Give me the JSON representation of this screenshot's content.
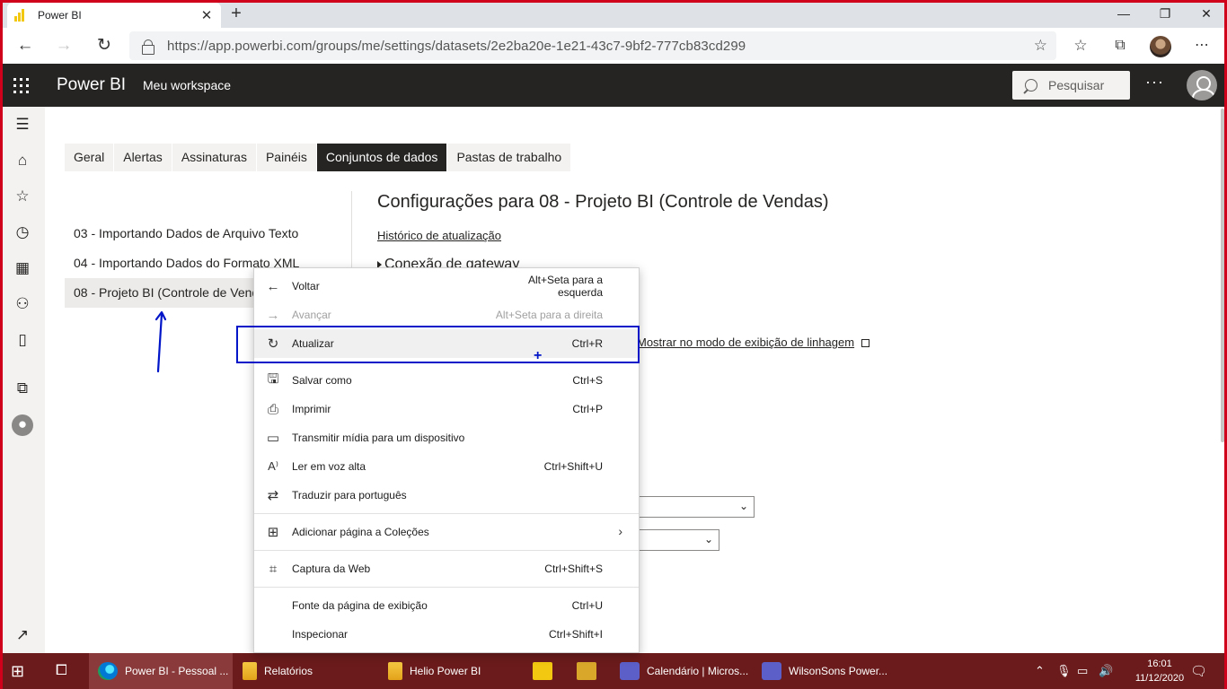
{
  "browser": {
    "tab_title": "Power BI",
    "url": "https://app.powerbi.com/groups/me/settings/datasets/2e2ba20e-1e21-43c7-9bf2-777cb83cd299"
  },
  "header": {
    "brand": "Power BI",
    "workspace": "Meu workspace",
    "search_placeholder": "Pesquisar"
  },
  "settings_tabs": [
    {
      "label": "Geral"
    },
    {
      "label": "Alertas"
    },
    {
      "label": "Assinaturas"
    },
    {
      "label": "Painéis"
    },
    {
      "label": "Conjuntos de dados",
      "active": true
    },
    {
      "label": "Pastas de trabalho"
    }
  ],
  "datasets": [
    {
      "label": "03 - Importando Dados de Arquivo Texto"
    },
    {
      "label": "04 - Importando Dados do Formato XML"
    },
    {
      "label": "08 - Projeto BI (Controle de Vendas)",
      "selected": true
    }
  ],
  "settings": {
    "title": "Configurações para 08 - Projeto BI (Controle de Vendas)",
    "refresh_history_link": "Histórico de atualização",
    "gateway_section": "Conexão de gateway",
    "lineage_link": "Mostrar no modo de exibição de linhagem"
  },
  "context_menu": {
    "items": [
      {
        "label": "Voltar",
        "shortcut": "Alt+Seta para a esquerda",
        "icon": "←"
      },
      {
        "label": "Avançar",
        "shortcut": "Alt+Seta para a direita",
        "icon": "→",
        "disabled": true
      },
      {
        "label": "Atualizar",
        "shortcut": "Ctrl+R",
        "icon": "↻",
        "highlighted": true
      },
      {
        "label": "Salvar como",
        "shortcut": "Ctrl+S",
        "icon": "🖫"
      },
      {
        "label": "Imprimir",
        "shortcut": "Ctrl+P",
        "icon": "⎙"
      },
      {
        "label": "Transmitir mídia para um dispositivo",
        "shortcut": "",
        "icon": "▭"
      },
      {
        "label": "Ler em voz alta",
        "shortcut": "Ctrl+Shift+U",
        "icon": "A⁾"
      },
      {
        "label": "Traduzir para português",
        "shortcut": "",
        "icon": "⇄"
      },
      {
        "label": "Adicionar página a Coleções",
        "shortcut": "",
        "icon": "⊞"
      },
      {
        "label": "Captura da Web",
        "shortcut": "Ctrl+Shift+S",
        "icon": "⌗"
      },
      {
        "label": "Fonte da página de exibição",
        "shortcut": "Ctrl+U",
        "icon": ""
      },
      {
        "label": "Inspecionar",
        "shortcut": "Ctrl+Shift+I",
        "icon": ""
      }
    ]
  },
  "taskbar": {
    "items": [
      {
        "label": "Power BI - Pessoal ...",
        "active": true
      },
      {
        "label": "Relatórios"
      },
      {
        "label": "Helio Power BI"
      },
      {
        "label": "Calendário | Micros..."
      },
      {
        "label": "WilsonSons Power..."
      }
    ],
    "time": "16:01",
    "date": "11/12/2020"
  },
  "colors": {
    "pbi_header": "#252423",
    "annotation": "#0015c8",
    "taskbar": "#6b1b1b",
    "window_border": "#d0021b"
  }
}
